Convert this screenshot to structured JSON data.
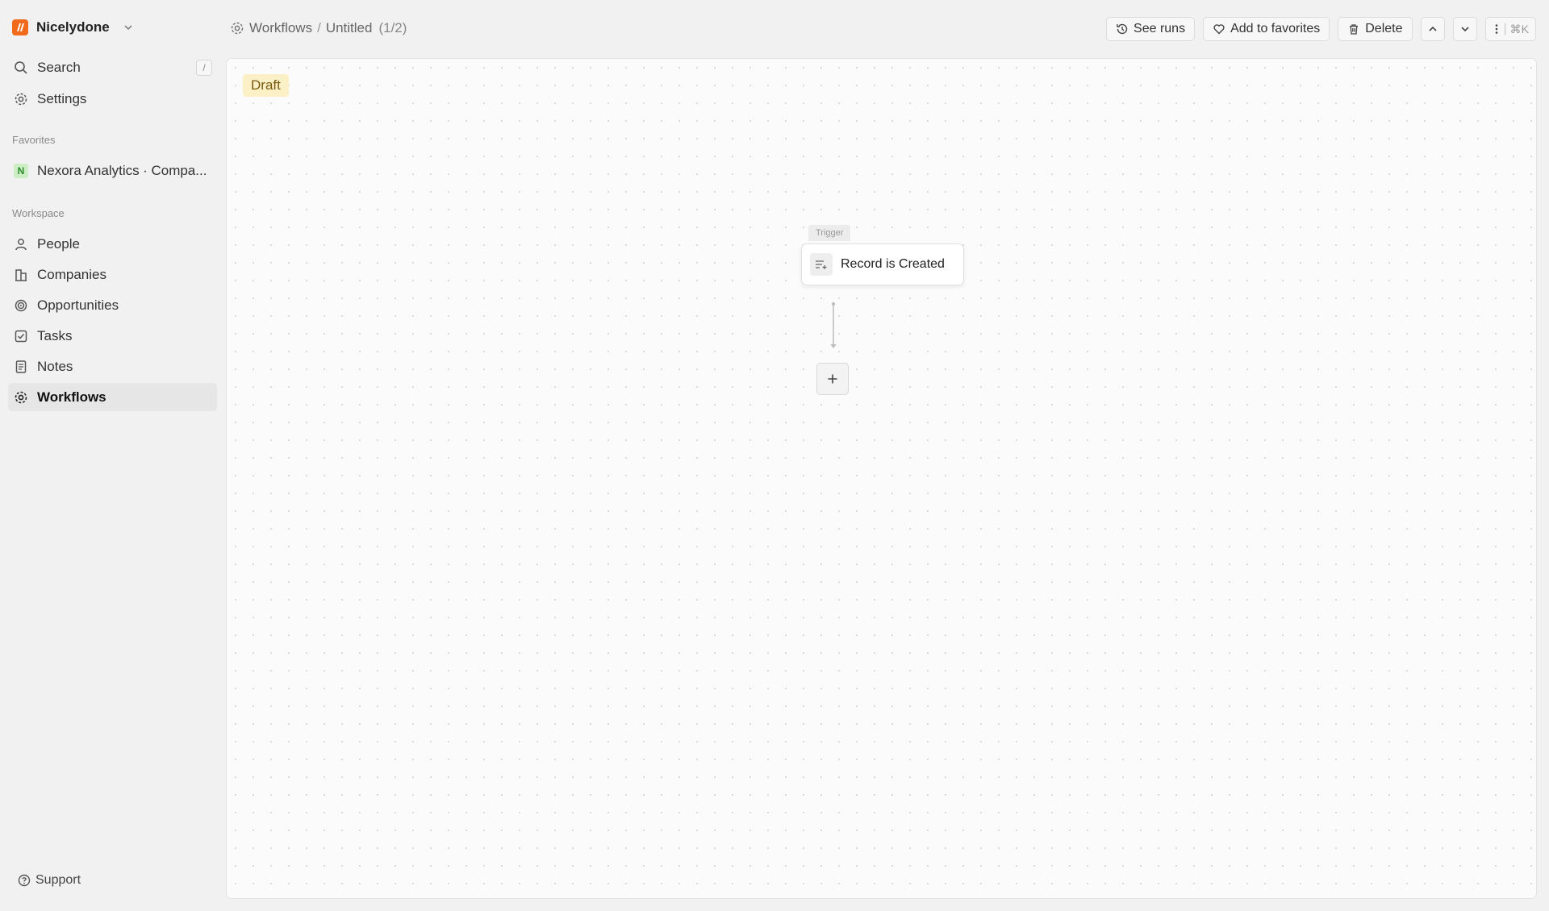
{
  "workspace": {
    "name": "Nicelydone",
    "logo_color": "#f26a1b"
  },
  "sidebar": {
    "search": {
      "label": "Search",
      "shortcut": "/"
    },
    "settings": {
      "label": "Settings"
    },
    "favorites": {
      "title": "Favorites",
      "items": [
        {
          "badge": "N",
          "label": "Nexora Analytics",
          "sub": "· Compa..."
        }
      ]
    },
    "workspace_section": {
      "title": "Workspace",
      "items": [
        {
          "label": "People",
          "icon": "person-icon"
        },
        {
          "label": "Companies",
          "icon": "building-icon"
        },
        {
          "label": "Opportunities",
          "icon": "target-icon"
        },
        {
          "label": "Tasks",
          "icon": "checkbox-icon"
        },
        {
          "label": "Notes",
          "icon": "note-icon"
        },
        {
          "label": "Workflows",
          "icon": "gear-icon",
          "active": true
        }
      ]
    },
    "support": {
      "label": "Support"
    }
  },
  "header": {
    "breadcrumb": {
      "root": "Workflows",
      "separator": "/",
      "current": "Untitled",
      "count": "(1/2)"
    },
    "actions": {
      "see_runs": "See runs",
      "add_favorites": "Add to favorites",
      "delete": "Delete",
      "more_shortcut": "⌘K"
    }
  },
  "canvas": {
    "status": "Draft",
    "trigger": {
      "tag": "Trigger",
      "label": "Record is Created"
    }
  },
  "colors": {
    "accent": "#f26a1b",
    "draft_bg": "#fbf0c6"
  }
}
